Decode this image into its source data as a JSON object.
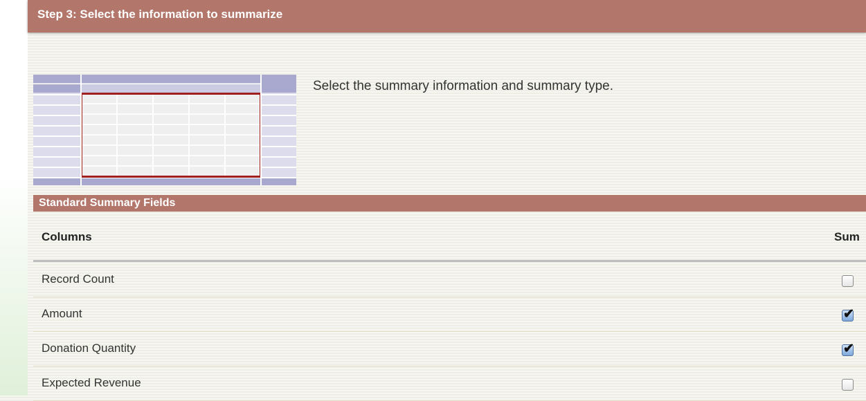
{
  "header": {
    "title": "Step 3: Select the information to summarize"
  },
  "intro": {
    "text": "Select the summary information and summary type."
  },
  "section": {
    "title": "Standard Summary Fields"
  },
  "table": {
    "columns_header": "Columns",
    "sum_header": "Sum",
    "rows": [
      {
        "label": "Record Count",
        "sum_checked": false
      },
      {
        "label": "Amount",
        "sum_checked": true
      },
      {
        "label": "Donation Quantity",
        "sum_checked": true
      },
      {
        "label": "Expected Revenue",
        "sum_checked": false
      }
    ]
  },
  "icons": {
    "checkmark": "✔"
  },
  "colors": {
    "header_bg": "#b2766b",
    "thumb_frame": "#a21f1f",
    "thumb_accent": "#a9a9cf"
  }
}
